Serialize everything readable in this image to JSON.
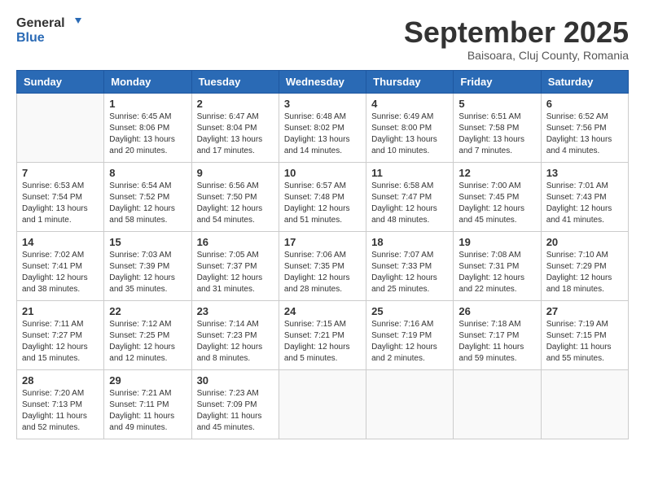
{
  "header": {
    "logo_general": "General",
    "logo_blue": "Blue",
    "month": "September 2025",
    "location": "Baisoara, Cluj County, Romania"
  },
  "weekdays": [
    "Sunday",
    "Monday",
    "Tuesday",
    "Wednesday",
    "Thursday",
    "Friday",
    "Saturday"
  ],
  "weeks": [
    [
      {
        "day": "",
        "info": ""
      },
      {
        "day": "1",
        "info": "Sunrise: 6:45 AM\nSunset: 8:06 PM\nDaylight: 13 hours\nand 20 minutes."
      },
      {
        "day": "2",
        "info": "Sunrise: 6:47 AM\nSunset: 8:04 PM\nDaylight: 13 hours\nand 17 minutes."
      },
      {
        "day": "3",
        "info": "Sunrise: 6:48 AM\nSunset: 8:02 PM\nDaylight: 13 hours\nand 14 minutes."
      },
      {
        "day": "4",
        "info": "Sunrise: 6:49 AM\nSunset: 8:00 PM\nDaylight: 13 hours\nand 10 minutes."
      },
      {
        "day": "5",
        "info": "Sunrise: 6:51 AM\nSunset: 7:58 PM\nDaylight: 13 hours\nand 7 minutes."
      },
      {
        "day": "6",
        "info": "Sunrise: 6:52 AM\nSunset: 7:56 PM\nDaylight: 13 hours\nand 4 minutes."
      }
    ],
    [
      {
        "day": "7",
        "info": "Sunrise: 6:53 AM\nSunset: 7:54 PM\nDaylight: 13 hours\nand 1 minute."
      },
      {
        "day": "8",
        "info": "Sunrise: 6:54 AM\nSunset: 7:52 PM\nDaylight: 12 hours\nand 58 minutes."
      },
      {
        "day": "9",
        "info": "Sunrise: 6:56 AM\nSunset: 7:50 PM\nDaylight: 12 hours\nand 54 minutes."
      },
      {
        "day": "10",
        "info": "Sunrise: 6:57 AM\nSunset: 7:48 PM\nDaylight: 12 hours\nand 51 minutes."
      },
      {
        "day": "11",
        "info": "Sunrise: 6:58 AM\nSunset: 7:47 PM\nDaylight: 12 hours\nand 48 minutes."
      },
      {
        "day": "12",
        "info": "Sunrise: 7:00 AM\nSunset: 7:45 PM\nDaylight: 12 hours\nand 45 minutes."
      },
      {
        "day": "13",
        "info": "Sunrise: 7:01 AM\nSunset: 7:43 PM\nDaylight: 12 hours\nand 41 minutes."
      }
    ],
    [
      {
        "day": "14",
        "info": "Sunrise: 7:02 AM\nSunset: 7:41 PM\nDaylight: 12 hours\nand 38 minutes."
      },
      {
        "day": "15",
        "info": "Sunrise: 7:03 AM\nSunset: 7:39 PM\nDaylight: 12 hours\nand 35 minutes."
      },
      {
        "day": "16",
        "info": "Sunrise: 7:05 AM\nSunset: 7:37 PM\nDaylight: 12 hours\nand 31 minutes."
      },
      {
        "day": "17",
        "info": "Sunrise: 7:06 AM\nSunset: 7:35 PM\nDaylight: 12 hours\nand 28 minutes."
      },
      {
        "day": "18",
        "info": "Sunrise: 7:07 AM\nSunset: 7:33 PM\nDaylight: 12 hours\nand 25 minutes."
      },
      {
        "day": "19",
        "info": "Sunrise: 7:08 AM\nSunset: 7:31 PM\nDaylight: 12 hours\nand 22 minutes."
      },
      {
        "day": "20",
        "info": "Sunrise: 7:10 AM\nSunset: 7:29 PM\nDaylight: 12 hours\nand 18 minutes."
      }
    ],
    [
      {
        "day": "21",
        "info": "Sunrise: 7:11 AM\nSunset: 7:27 PM\nDaylight: 12 hours\nand 15 minutes."
      },
      {
        "day": "22",
        "info": "Sunrise: 7:12 AM\nSunset: 7:25 PM\nDaylight: 12 hours\nand 12 minutes."
      },
      {
        "day": "23",
        "info": "Sunrise: 7:14 AM\nSunset: 7:23 PM\nDaylight: 12 hours\nand 8 minutes."
      },
      {
        "day": "24",
        "info": "Sunrise: 7:15 AM\nSunset: 7:21 PM\nDaylight: 12 hours\nand 5 minutes."
      },
      {
        "day": "25",
        "info": "Sunrise: 7:16 AM\nSunset: 7:19 PM\nDaylight: 12 hours\nand 2 minutes."
      },
      {
        "day": "26",
        "info": "Sunrise: 7:18 AM\nSunset: 7:17 PM\nDaylight: 11 hours\nand 59 minutes."
      },
      {
        "day": "27",
        "info": "Sunrise: 7:19 AM\nSunset: 7:15 PM\nDaylight: 11 hours\nand 55 minutes."
      }
    ],
    [
      {
        "day": "28",
        "info": "Sunrise: 7:20 AM\nSunset: 7:13 PM\nDaylight: 11 hours\nand 52 minutes."
      },
      {
        "day": "29",
        "info": "Sunrise: 7:21 AM\nSunset: 7:11 PM\nDaylight: 11 hours\nand 49 minutes."
      },
      {
        "day": "30",
        "info": "Sunrise: 7:23 AM\nSunset: 7:09 PM\nDaylight: 11 hours\nand 45 minutes."
      },
      {
        "day": "",
        "info": ""
      },
      {
        "day": "",
        "info": ""
      },
      {
        "day": "",
        "info": ""
      },
      {
        "day": "",
        "info": ""
      }
    ]
  ]
}
